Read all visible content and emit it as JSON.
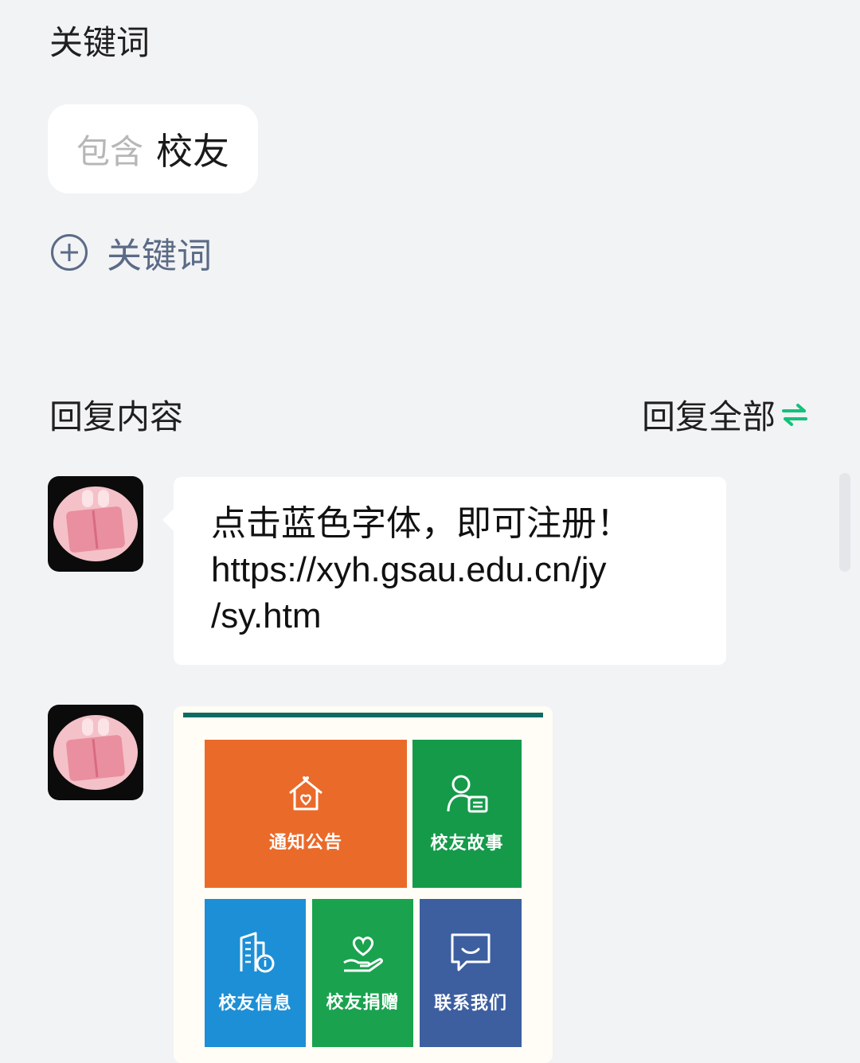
{
  "keyword_section": {
    "title": "关键词",
    "chip": {
      "prefix": "包含",
      "value": "校友"
    },
    "add_label": "关键词"
  },
  "reply_section": {
    "title": "回复内容",
    "reply_all_label": "回复全部",
    "reply_all_icon": "swap-arrows-icon"
  },
  "messages": [
    {
      "type": "text",
      "avatar": "pink-bunny-reading-avatar",
      "text": "点击蓝色字体，即可注册！\nhttps://xyh.gsau.edu.cn/jy\n/sy.htm"
    },
    {
      "type": "image",
      "avatar": "pink-bunny-reading-avatar",
      "tiles": [
        {
          "label": "通知公告",
          "icon": "house-heart-icon",
          "color": "#ea6a2a"
        },
        {
          "label": "校友故事",
          "icon": "person-document-icon",
          "color": "#159a4a"
        },
        {
          "label": "校友信息",
          "icon": "building-info-icon",
          "color": "#1c8fd6"
        },
        {
          "label": "校友捐赠",
          "icon": "hand-heart-icon",
          "color": "#1aa24f"
        },
        {
          "label": "联系我们",
          "icon": "chat-bubble-icon",
          "color": "#3d5fa0"
        }
      ]
    }
  ],
  "colors": {
    "accent_green": "#13c27a",
    "link_gray_blue": "#5b6b86",
    "background": "#f2f3f5"
  }
}
